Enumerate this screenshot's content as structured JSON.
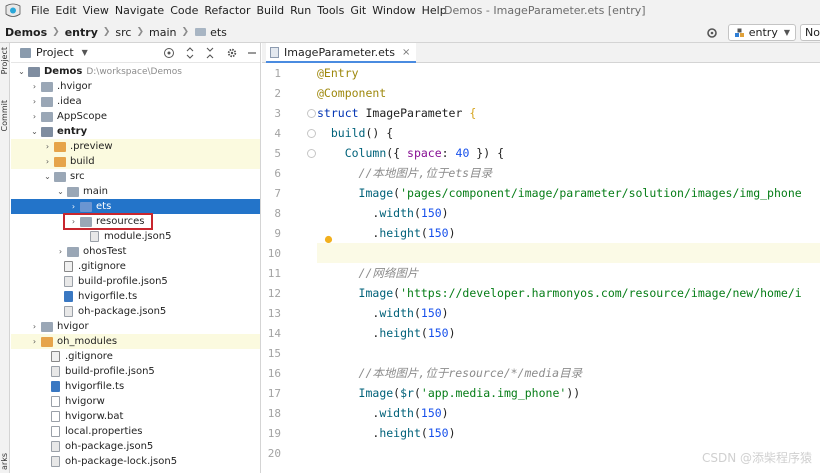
{
  "menubar": {
    "items": [
      "File",
      "Edit",
      "View",
      "Navigate",
      "Code",
      "Refactor",
      "Build",
      "Run",
      "Tools",
      "Git",
      "Window",
      "Help"
    ],
    "window_title": "Demos - ImageParameter.ets [entry]"
  },
  "navbar": {
    "breadcrumbs": [
      "Demos",
      "entry",
      "src",
      "main",
      "ets"
    ],
    "config": "entry",
    "device": "No"
  },
  "toolstrip": {
    "tabs": [
      "Project",
      "Commit",
      "arks"
    ]
  },
  "project_panel": {
    "title": "Project",
    "tree": [
      {
        "label": "Demos",
        "path": "D:\\workspace\\Demos",
        "bold": true
      },
      {
        "label": ".hvigor"
      },
      {
        "label": ".idea"
      },
      {
        "label": "AppScope"
      },
      {
        "label": "entry",
        "bold": true
      },
      {
        "label": ".preview"
      },
      {
        "label": "build"
      },
      {
        "label": "src"
      },
      {
        "label": "main"
      },
      {
        "label": "ets"
      },
      {
        "label": "resources"
      },
      {
        "label": "module.json5"
      },
      {
        "label": "ohosTest"
      },
      {
        "label": ".gitignore"
      },
      {
        "label": "build-profile.json5"
      },
      {
        "label": "hvigorfile.ts"
      },
      {
        "label": "oh-package.json5"
      },
      {
        "label": "hvigor"
      },
      {
        "label": "oh_modules"
      },
      {
        "label": ".gitignore"
      },
      {
        "label": "build-profile.json5"
      },
      {
        "label": "hvigorfile.ts"
      },
      {
        "label": "hvigorw"
      },
      {
        "label": "hvigorw.bat"
      },
      {
        "label": "local.properties"
      },
      {
        "label": "oh-package.json5"
      },
      {
        "label": "oh-package-lock.json5"
      }
    ]
  },
  "editor": {
    "tab_label": "ImageParameter.ets",
    "line_numbers": [
      "1",
      "2",
      "3",
      "4",
      "5",
      "6",
      "7",
      "8",
      "9",
      "10",
      "11",
      "12",
      "13",
      "14",
      "15",
      "16",
      "17",
      "18",
      "19",
      "20"
    ],
    "code": {
      "l1": "@Entry",
      "l2": "@Component",
      "l3_kw": "struct",
      "l3_name": " ImageParameter ",
      "l3_brace": "{",
      "l4_fn": "build",
      "l4_rest": "() {",
      "l5_fn": "Column",
      "l5_a": "({ ",
      "l5_prop": "space",
      "l5_b": ": ",
      "l5_num": "40",
      "l5_c": " }) {",
      "l6": "//本地图片,位于ets目录",
      "l7_fn": "Image",
      "l7_a": "(",
      "l7_str": "'pages/component/image/parameter/solution/images/img_phone",
      "l8_a": ".",
      "l8_m": "width",
      "l8_b": "(",
      "l8_num": "150",
      "l8_c": ")",
      "l9_a": ".",
      "l9_m": "height",
      "l9_b": "(",
      "l9_num": "150",
      "l9_c": ")",
      "l11": "//网络图片",
      "l12_fn": "Image",
      "l12_a": "(",
      "l12_str": "'https://developer.harmonyos.com/resource/image/new/home/i",
      "l13_a": ".",
      "l13_m": "width",
      "l13_b": "(",
      "l13_num": "150",
      "l13_c": ")",
      "l14_a": ".",
      "l14_m": "height",
      "l14_b": "(",
      "l14_num": "150",
      "l14_c": ")",
      "l16": "//本地图片,位于resource/*/media目录",
      "l17_fn": "Image",
      "l17_a": "(",
      "l17_r": "$r",
      "l17_b": "(",
      "l17_str": "'app.media.img_phone'",
      "l17_c": "))",
      "l18_a": ".",
      "l18_m": "width",
      "l18_b": "(",
      "l18_num": "150",
      "l18_c": ")",
      "l19_a": ".",
      "l19_m": "height",
      "l19_b": "(",
      "l19_num": "150",
      "l19_c": ")"
    }
  },
  "watermark": "CSDN @添柴程序猿",
  "colors": {
    "accent": "#2374c9",
    "annotation_box": "#c8262e",
    "highlight_row": "#fbfadf"
  }
}
